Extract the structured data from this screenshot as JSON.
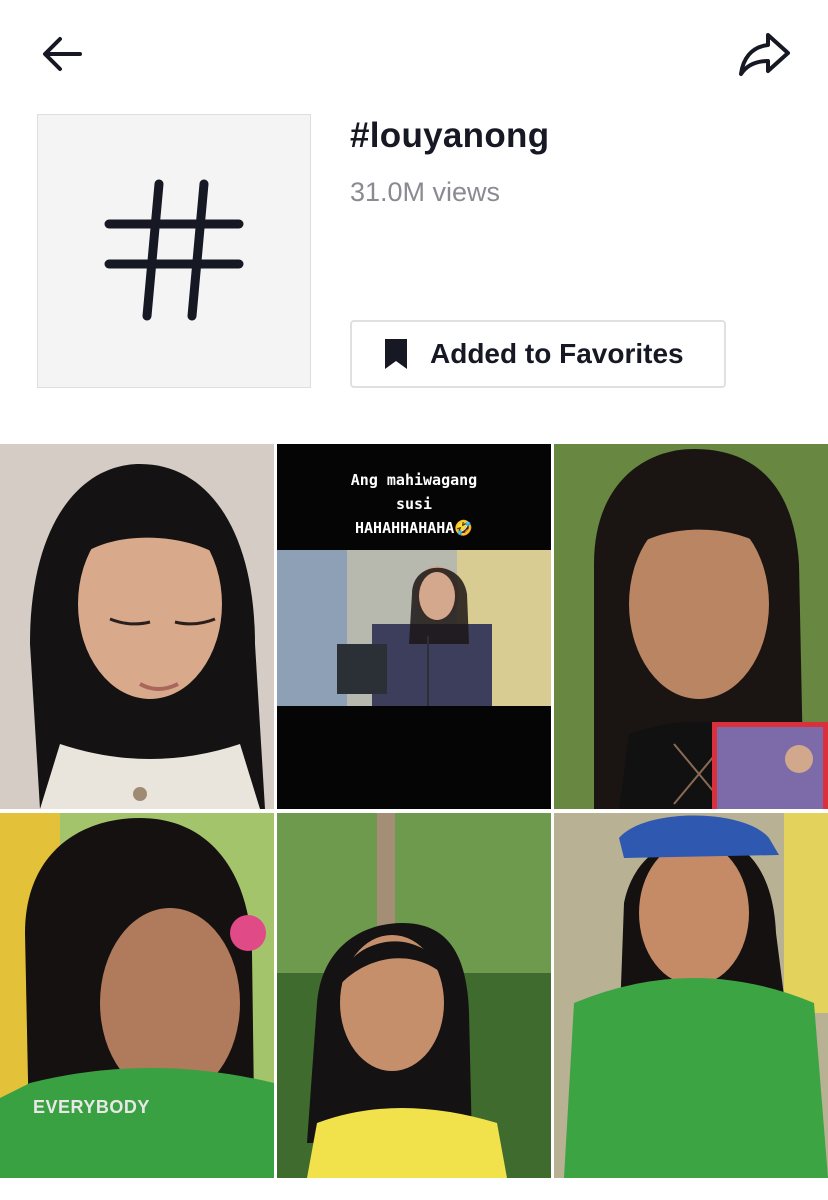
{
  "header": {
    "back_icon": "arrow-left-icon",
    "share_icon": "share-arrow-icon"
  },
  "hashtag": {
    "title": "#louyanong",
    "views": "31.0M views",
    "cover_icon": "hash-icon",
    "favorite_button": {
      "label": "Added to Favorites",
      "icon": "bookmark-filled-icon"
    }
  },
  "videos": [
    {
      "caption": ""
    },
    {
      "caption_line1": "Ang mahiwagang",
      "caption_line2": "susi",
      "caption_line3": "HAHAHHAHAHA🤣"
    },
    {
      "caption": ""
    },
    {
      "caption": "EVERYBODY"
    },
    {
      "caption": ""
    },
    {
      "caption": ""
    }
  ]
}
